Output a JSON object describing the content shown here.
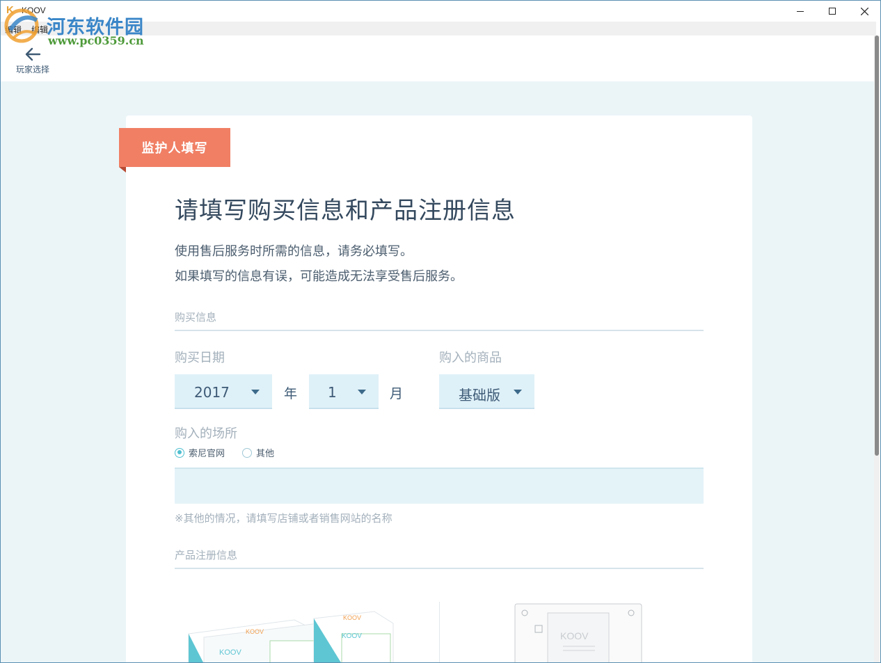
{
  "window": {
    "app_title": "KOOV",
    "app_logo": "K",
    "controls": {
      "minimize": "minimize",
      "maximize": "maximize",
      "close": "close"
    }
  },
  "menu": {
    "items": [
      "编辑",
      "编辑"
    ]
  },
  "watermark": {
    "text": "河东软件园",
    "url": "www.pc0359.cn"
  },
  "nav": {
    "back_label": "玩家选择",
    "back_icon": "arrow-left-icon"
  },
  "form": {
    "ribbon": "监护人填写",
    "title": "请填写购买信息和产品注册信息",
    "desc_line1": "使用售后服务时所需的信息，请务必填写。",
    "desc_line2": "如果填写的信息有误，可能造成无法享受售后服务。",
    "purchase_section": "购买信息",
    "date_label": "购买日期",
    "year_value": "2017",
    "year_unit": "年",
    "month_value": "1",
    "month_unit": "月",
    "product_label": "购入的商品",
    "product_value": "基础版",
    "place_label": "购入的场所",
    "place_options": [
      {
        "label": "索尼官网",
        "selected": true
      },
      {
        "label": "其他",
        "selected": false
      }
    ],
    "place_input_value": "",
    "place_note": "※其他的情况，请填写店铺或者销售网站的名称",
    "product_section": "产品注册信息"
  },
  "colors": {
    "accent_ribbon": "#f07f64",
    "select_bg": "#dff1f8",
    "page_bg": "#ebf5f8",
    "radio_on": "#4fbfd0"
  }
}
